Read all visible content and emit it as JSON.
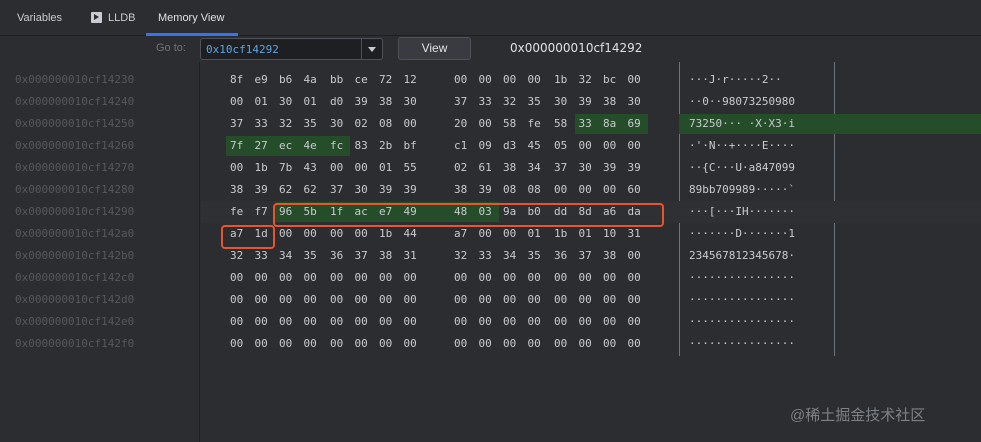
{
  "tabs": [
    {
      "label": "Variables",
      "icon": "none"
    },
    {
      "label": "LLDB",
      "icon": "console-play-icon"
    },
    {
      "label": "Memory View",
      "icon": "none"
    }
  ],
  "toolbar": {
    "goto_label": "Go to:",
    "goto_value": "0x10cf14292",
    "view_label": "View",
    "address_display": "0x000000010cf14292"
  },
  "colors": {
    "accent": "#3574f0",
    "highlight": "#254d29",
    "selection_box": "#e8542b",
    "address_text": "#55585d"
  },
  "rows": [
    {
      "addr": "0x000000010cf14230",
      "bytes": [
        "8f",
        "e9",
        "b6",
        "4a",
        "bb",
        "ce",
        "72",
        "12",
        "00",
        "00",
        "00",
        "00",
        "1b",
        "32",
        "bc",
        "00"
      ],
      "ascii": "···J·r·····2··"
    },
    {
      "addr": "0x000000010cf14240",
      "bytes": [
        "00",
        "01",
        "30",
        "01",
        "d0",
        "39",
        "38",
        "30",
        "37",
        "33",
        "32",
        "35",
        "30",
        "39",
        "38",
        "30"
      ],
      "ascii": "··0··98073250980"
    },
    {
      "addr": "0x000000010cf14250",
      "bytes": [
        "37",
        "33",
        "32",
        "35",
        "30",
        "02",
        "08",
        "00",
        "20",
        "00",
        "58",
        "fe",
        "58",
        "33",
        "8a",
        "69"
      ],
      "ascii": "73250··· ·X·X3·i"
    },
    {
      "addr": "0x000000010cf14260",
      "bytes": [
        "7f",
        "27",
        "ec",
        "4e",
        "fc",
        "83",
        "2b",
        "bf",
        "c1",
        "09",
        "d3",
        "45",
        "05",
        "00",
        "00",
        "00"
      ],
      "ascii": "·'·N··+····E····"
    },
    {
      "addr": "0x000000010cf14270",
      "bytes": [
        "00",
        "1b",
        "7b",
        "43",
        "00",
        "00",
        "01",
        "55",
        "02",
        "61",
        "38",
        "34",
        "37",
        "30",
        "39",
        "39"
      ],
      "ascii": "··{C···U·a847099"
    },
    {
      "addr": "0x000000010cf14280",
      "bytes": [
        "38",
        "39",
        "62",
        "62",
        "37",
        "30",
        "39",
        "39",
        "38",
        "39",
        "08",
        "08",
        "00",
        "00",
        "00",
        "60"
      ],
      "ascii": "89bb709989·····`"
    },
    {
      "addr": "0x000000010cf14290",
      "bytes": [
        "fe",
        "f7",
        "96",
        "5b",
        "1f",
        "ac",
        "e7",
        "49",
        "48",
        "03",
        "9a",
        "b0",
        "dd",
        "8d",
        "a6",
        "da"
      ],
      "ascii": "···[···IH·······"
    },
    {
      "addr": "0x000000010cf142a0",
      "bytes": [
        "a7",
        "1d",
        "00",
        "00",
        "00",
        "00",
        "1b",
        "44",
        "a7",
        "00",
        "00",
        "01",
        "1b",
        "01",
        "10",
        "31"
      ],
      "ascii": "·······D·······1"
    },
    {
      "addr": "0x000000010cf142b0",
      "bytes": [
        "32",
        "33",
        "34",
        "35",
        "36",
        "37",
        "38",
        "31",
        "32",
        "33",
        "34",
        "35",
        "36",
        "37",
        "38",
        "00"
      ],
      "ascii": "234567812345678·"
    },
    {
      "addr": "0x000000010cf142c0",
      "bytes": [
        "00",
        "00",
        "00",
        "00",
        "00",
        "00",
        "00",
        "00",
        "00",
        "00",
        "00",
        "00",
        "00",
        "00",
        "00",
        "00"
      ],
      "ascii": "················"
    },
    {
      "addr": "0x000000010cf142d0",
      "bytes": [
        "00",
        "00",
        "00",
        "00",
        "00",
        "00",
        "00",
        "00",
        "00",
        "00",
        "00",
        "00",
        "00",
        "00",
        "00",
        "00"
      ],
      "ascii": "················"
    },
    {
      "addr": "0x000000010cf142e0",
      "bytes": [
        "00",
        "00",
        "00",
        "00",
        "00",
        "00",
        "00",
        "00",
        "00",
        "00",
        "00",
        "00",
        "00",
        "00",
        "00",
        "00"
      ],
      "ascii": "················"
    },
    {
      "addr": "0x000000010cf142f0",
      "bytes": [
        "00",
        "00",
        "00",
        "00",
        "00",
        "00",
        "00",
        "00",
        "00",
        "00",
        "00",
        "00",
        "00",
        "00",
        "00",
        "00"
      ],
      "ascii": "················"
    }
  ],
  "watermark": "@稀土掘金技术社区"
}
